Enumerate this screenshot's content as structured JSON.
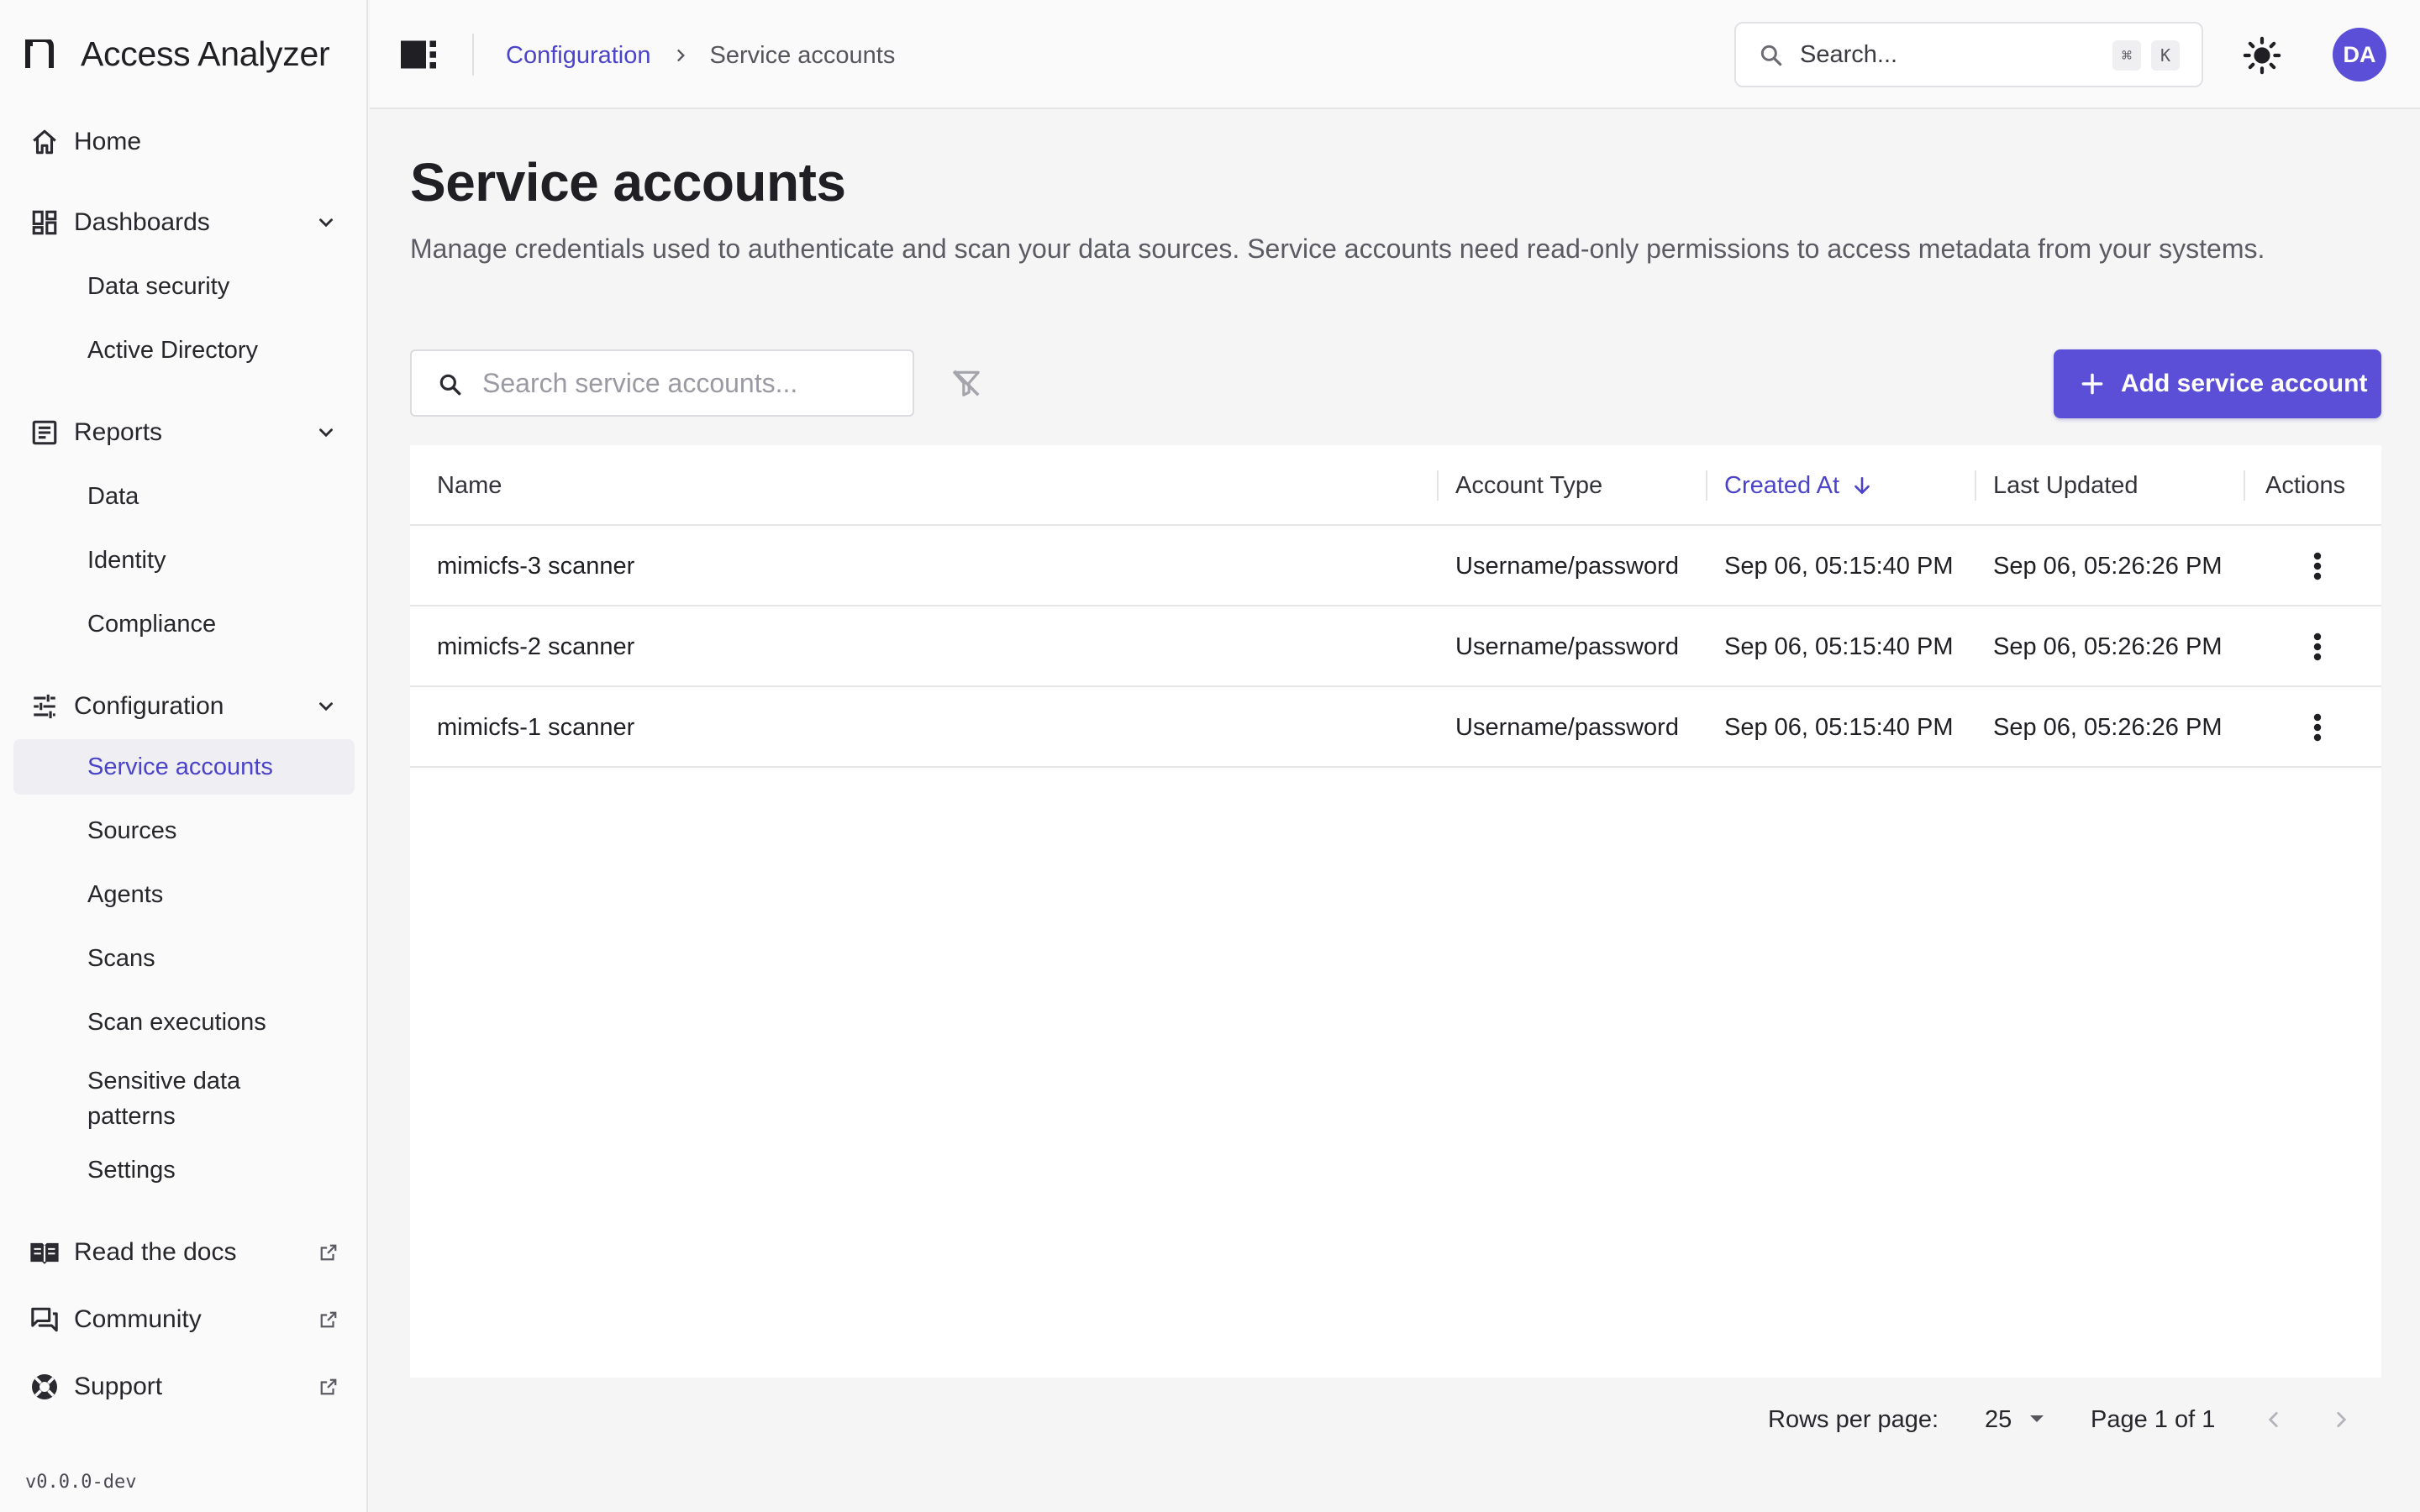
{
  "app": {
    "title": "Access Analyzer",
    "version": "v0.0.0-dev"
  },
  "sidebar": {
    "home": "Home",
    "dashboards": {
      "label": "Dashboards",
      "items": [
        "Data security",
        "Active Directory"
      ]
    },
    "reports": {
      "label": "Reports",
      "items": [
        "Data",
        "Identity",
        "Compliance"
      ]
    },
    "configuration": {
      "label": "Configuration",
      "items": [
        "Service accounts",
        "Sources",
        "Agents",
        "Scans",
        "Scan executions",
        "Sensitive data patterns",
        "Settings"
      ],
      "active_item": "Service accounts"
    },
    "links": [
      "Read the docs",
      "Community",
      "Support"
    ]
  },
  "topbar": {
    "breadcrumb": {
      "parent": "Configuration",
      "current": "Service accounts"
    },
    "search": {
      "placeholder": "Search...",
      "shortcut_keys": [
        "⌘",
        "K"
      ]
    },
    "avatar_initials": "DA"
  },
  "main": {
    "title": "Service accounts",
    "description": "Manage credentials used to authenticate and scan your data sources. Service accounts need read-only permissions to access metadata from your systems.",
    "search_placeholder": "Search service accounts...",
    "add_button_label": "Add service account",
    "table": {
      "columns": [
        "Name",
        "Account Type",
        "Created At",
        "Last Updated",
        "Actions"
      ],
      "sorted_column": "Created At",
      "sort_direction": "desc",
      "rows": [
        {
          "name": "mimicfs-3 scanner",
          "type": "Username/password",
          "created": "Sep 06, 05:15:40 PM",
          "updated": "Sep 06, 05:26:26 PM"
        },
        {
          "name": "mimicfs-2 scanner",
          "type": "Username/password",
          "created": "Sep 06, 05:15:40 PM",
          "updated": "Sep 06, 05:26:26 PM"
        },
        {
          "name": "mimicfs-1 scanner",
          "type": "Username/password",
          "created": "Sep 06, 05:15:40 PM",
          "updated": "Sep 06, 05:26:26 PM"
        }
      ]
    },
    "pagination": {
      "rows_per_page_label": "Rows per page:",
      "rows_per_page": "25",
      "page_info": "Page 1 of 1"
    }
  },
  "colors": {
    "accent": "#5a4fd6",
    "accent_text": "#4b43c8",
    "sidebar_bg": "#fafafa",
    "page_bg": "#f5f5f6"
  },
  "icons": [
    "home-icon",
    "dashboard-icon",
    "report-icon",
    "tune-icon",
    "book-icon",
    "chat-icon",
    "lifebuoy-icon",
    "external-link-icon",
    "chevron-down-icon",
    "search-icon",
    "sun-icon",
    "panel-toggle-icon",
    "filter-off-icon",
    "plus-icon",
    "more-vertical-icon",
    "arrow-down-icon",
    "chevron-left-icon",
    "chevron-right-icon"
  ]
}
